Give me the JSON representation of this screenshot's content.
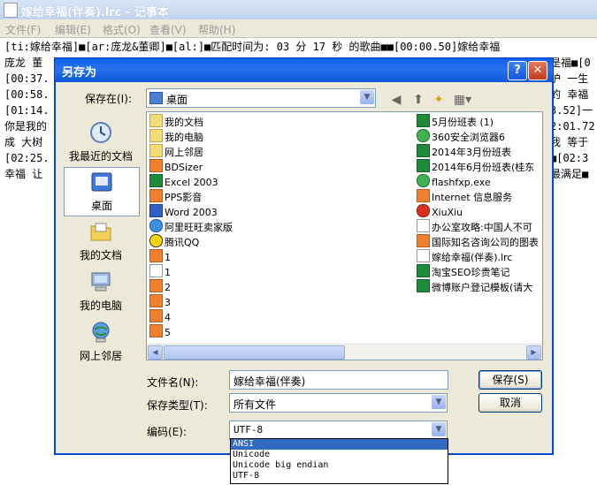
{
  "notepad": {
    "title": "嫁给幸福(伴奏).lrc - 记事本",
    "menu": [
      "文件(F)",
      "编辑(E)",
      "格式(O)",
      "查看(V)",
      "帮助(H)"
    ],
    "lines": [
      "[ti:嫁给幸福]■[ar:庞龙&董卿]■[al:]■匹配时间为: 03 分 17 秒 的歌曲■■[00:00.50]嫁给幸福",
      "庞龙 董",
      "[00:37.",
      "[00:58.",
      "[01:14.",
      "你是我的",
      "成 大树",
      "[02:25.",
      "幸福 让"
    ],
    "right_fragments": [
      "是福■[0",
      "护 一生",
      "的 幸福",
      "3.52]一",
      "2:01.72",
      "我 等于",
      "■[02:3",
      "最满足■"
    ]
  },
  "dialog": {
    "title": "另存为",
    "help_label": "?",
    "close_label": "✕",
    "save_in_label": "保存在(I):",
    "save_in_value": "桌面",
    "places": [
      {
        "label": "我最近的文档",
        "icon": "recent-docs-icon"
      },
      {
        "label": "桌面",
        "icon": "desktop-icon",
        "selected": true
      },
      {
        "label": "我的文档",
        "icon": "my-documents-icon"
      },
      {
        "label": "我的电脑",
        "icon": "my-computer-icon"
      },
      {
        "label": "网上邻居",
        "icon": "network-places-icon"
      }
    ],
    "files_left": [
      {
        "name": "我的文档",
        "type": "folder"
      },
      {
        "name": "我的电脑",
        "type": "folder"
      },
      {
        "name": "网上邻居",
        "type": "folder"
      },
      {
        "name": "BDSizer",
        "type": "app"
      },
      {
        "name": "Excel 2003",
        "type": "xls"
      },
      {
        "name": "PPS影音",
        "type": "app"
      },
      {
        "name": "Word 2003",
        "type": "doc"
      },
      {
        "name": "阿里旺旺卖家版",
        "type": "ie"
      },
      {
        "name": "腾讯QQ",
        "type": "qq"
      },
      {
        "name": "1",
        "type": "app"
      },
      {
        "name": "1",
        "type": "txt"
      },
      {
        "name": "2",
        "type": "app"
      },
      {
        "name": "3",
        "type": "app"
      },
      {
        "name": "4",
        "type": "app"
      },
      {
        "name": "5",
        "type": "app"
      }
    ],
    "files_right": [
      {
        "name": "5月份班表 (1)",
        "type": "xls"
      },
      {
        "name": "360安全浏览器6",
        "type": "green"
      },
      {
        "name": "2014年3月份班表",
        "type": "xls"
      },
      {
        "name": "2014年6月份班表(桂东",
        "type": "xls"
      },
      {
        "name": "flashfxp.exe",
        "type": "green"
      },
      {
        "name": "Internet 信息服务",
        "type": "app"
      },
      {
        "name": "XiuXiu",
        "type": "red"
      },
      {
        "name": "办公室攻略:中国人不可",
        "type": "txt"
      },
      {
        "name": "国际知名咨询公司的图表",
        "type": "app"
      },
      {
        "name": "嫁给幸福(伴奏).lrc",
        "type": "txt"
      },
      {
        "name": "淘宝SEO珍贵笔记",
        "type": "xls"
      },
      {
        "name": "微博账户登记模板(请大",
        "type": "xls"
      }
    ],
    "filename_label": "文件名(N):",
    "filename_value": "嫁给幸福(伴奏)",
    "filetype_label": "保存类型(T):",
    "filetype_value": "所有文件",
    "encoding_label": "编码(E):",
    "encoding_value": "UTF-8",
    "encoding_options": [
      "ANSI",
      "Unicode",
      "Unicode big endian",
      "UTF-8"
    ],
    "save_button": "保存(S)",
    "cancel_button": "取消"
  }
}
